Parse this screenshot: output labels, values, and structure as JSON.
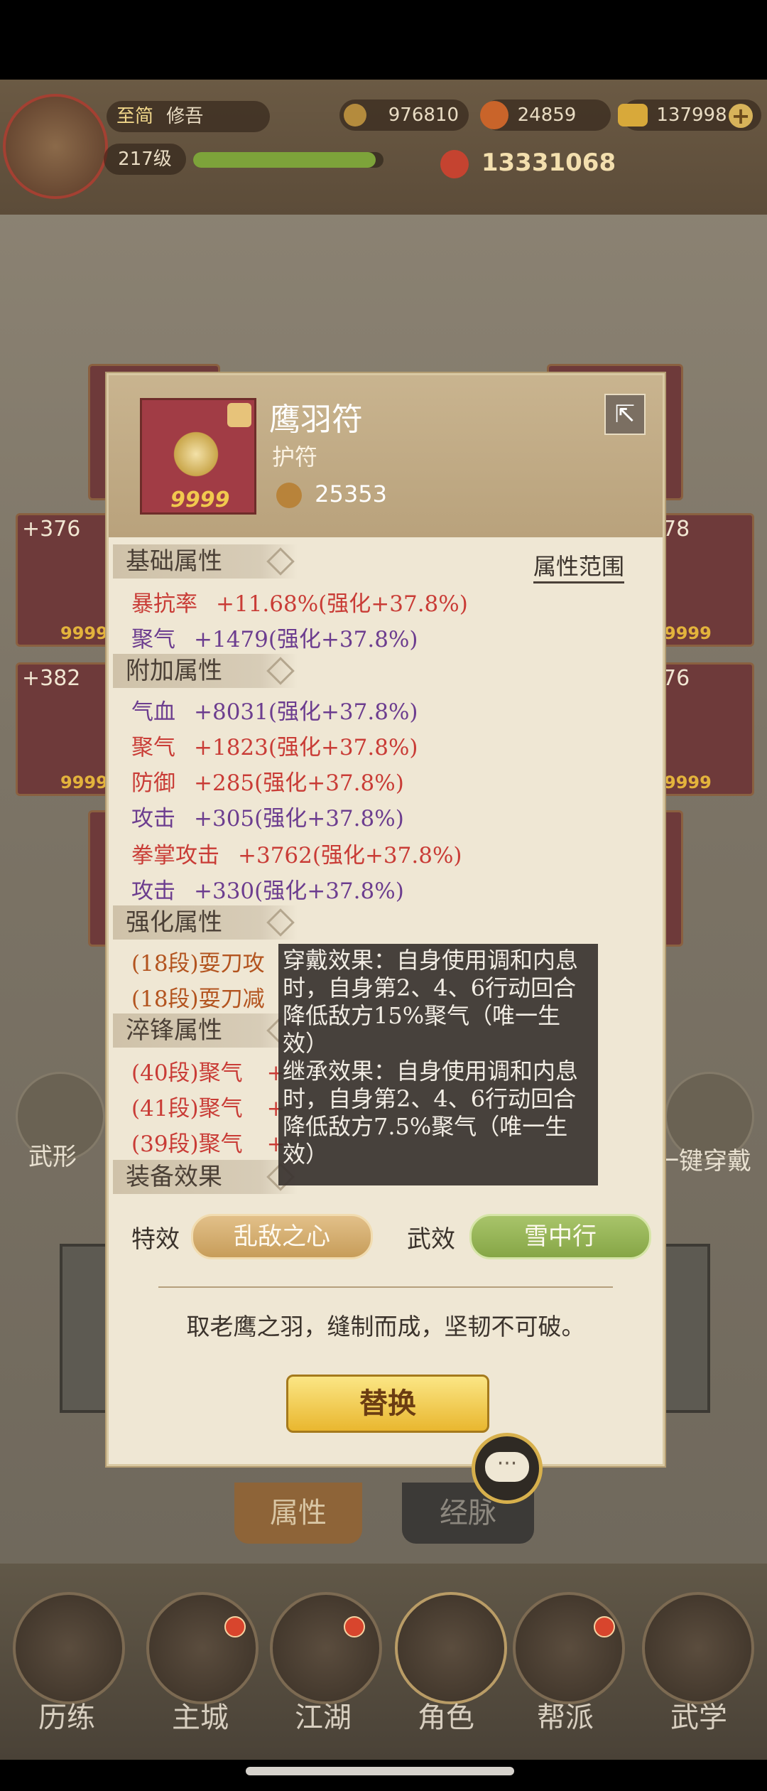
{
  "header": {
    "player_tag": "至简",
    "player_name": "修吾",
    "level": "217级",
    "coins": "976810",
    "jade": "24859",
    "gold": "137998",
    "power": "13331068"
  },
  "background": {
    "left_cards": [
      "+376",
      "+382"
    ],
    "right_cards": [
      "78",
      "76"
    ],
    "card_count": "9999",
    "left_action": "武形",
    "right_action": "一键穿戴",
    "tabs": [
      "属性",
      "经脉"
    ],
    "nav": [
      "历练",
      "主城",
      "江湖",
      "角色",
      "帮派",
      "武学"
    ]
  },
  "item": {
    "name": "鹰羽符",
    "type": "护符",
    "count": "9999",
    "power": "25353"
  },
  "sections": {
    "base": "基础属性",
    "extra": "附加属性",
    "enhance": "强化属性",
    "quench": "淬锋属性",
    "equip": "装备效果",
    "range_link": "属性范围"
  },
  "base_stats": [
    {
      "name": "暴抗率",
      "value": "+11.68%(强化+37.8%)",
      "color": "#c93c36"
    },
    {
      "name": "聚气",
      "value": "+1479(强化+37.8%)",
      "color": "#6c3d8f"
    }
  ],
  "extra_stats": [
    {
      "name": "气血",
      "value": "+8031(强化+37.8%)",
      "color": "#6c3d8f"
    },
    {
      "name": "聚气",
      "value": "+1823(强化+37.8%)",
      "color": "#c93c36"
    },
    {
      "name": "防御",
      "value": "+285(强化+37.8%)",
      "color": "#c93c36"
    },
    {
      "name": "攻击",
      "value": "+305(强化+37.8%)",
      "color": "#6c3d8f"
    },
    {
      "name": "拳掌攻击",
      "value": "+3762(强化+37.8%)",
      "color": "#c93c36"
    },
    {
      "name": "攻击",
      "value": "+330(强化+37.8%)",
      "color": "#6c3d8f"
    }
  ],
  "enhance_stats": [
    "(18段)耍刀攻",
    "(18段)耍刀减"
  ],
  "quench_stats": [
    {
      "name": "(40段)聚气",
      "value": "+"
    },
    {
      "name": "(41段)聚气",
      "value": "+"
    },
    {
      "name": "(39段)聚气",
      "value": "+"
    }
  ],
  "effects": {
    "special_label": "特效",
    "special_value": "乱敌之心",
    "martial_label": "武效",
    "martial_value": "雪中行"
  },
  "description": "取老鹰之羽，缝制而成，坚韧不可破。",
  "replace_button": "替换",
  "tooltip": {
    "wear": "穿戴效果：自身使用调和内息时，自身第2、4、6行动回合降低敌方15%聚气（唯一生效）",
    "inherit": "继承效果：自身使用调和内息时，自身第2、4、6行动回合降低敌方7.5%聚气（唯一生效）"
  }
}
